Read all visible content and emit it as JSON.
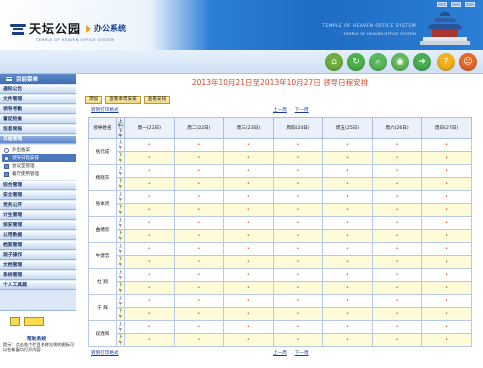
{
  "header": {
    "logo_text": "天坛公园",
    "logo_subtitle": "办公系统",
    "logo_en": "TEMPLE OF HEAVEN OFFICE SYSTEM",
    "en_title": "TEMPLE OF HEAVEN OFFICE SYSTEM",
    "en_subtitle": "TEMPLE OF HEAVEN OFFICE SYSTEM"
  },
  "toolbar": {
    "buttons": [
      {
        "icon": "home-icon",
        "color": "#6fae3e"
      },
      {
        "icon": "refresh-icon",
        "color": "#4bb04b"
      },
      {
        "icon": "search-icon",
        "color": "#58b85a"
      },
      {
        "icon": "zoom-icon",
        "color": "#63b85c"
      },
      {
        "icon": "forward-icon",
        "color": "#4aae52"
      },
      {
        "icon": "help-icon",
        "color": "#f3b31f"
      },
      {
        "icon": "user-icon",
        "color": "#e46a2b"
      }
    ]
  },
  "sidebar": {
    "title": "目前菜单",
    "items_top": [
      "通知公告",
      "文件管理",
      "领导考勤",
      "督促检查",
      "信息简报",
      "日程管理"
    ],
    "sub_items": [
      {
        "label": "外出备案",
        "selected": false
      },
      {
        "label": "领导日程安排",
        "selected": true
      },
      {
        "label": "会议室管理",
        "selected": false
      },
      {
        "label": "餐厅使用管理",
        "selected": false
      }
    ],
    "items_bottom": [
      "综合管理",
      "安全管理",
      "党务公开",
      "计生管理",
      "保安管理",
      "公用数据",
      "档案管理",
      "观子操作",
      "文档管理",
      "系统管理",
      "个人工具箱"
    ],
    "help_title": "帮助系统",
    "help_text": "提示：点击各个栏目名称左侧的图标可以在新窗口打开内容"
  },
  "main": {
    "title": "2013年10月21日至2013年10月27日 领导日程安排",
    "buttons": [
      "添加",
      "查看本周安排",
      "查看安排"
    ],
    "print_link": "转到打印格式",
    "prev_week": "上一周",
    "next_week": "下一周",
    "table": {
      "name_header": "领导姓名",
      "ap_header": "上午/下午",
      "am_label": "上午",
      "pm_label": "下午",
      "dot": "•",
      "days": [
        "周一(21日)",
        "周二(22日)",
        "周三(23日)",
        "周四(24日)",
        "周五(25日)",
        "周六(26日)",
        "周日(27日)"
      ],
      "leaders": [
        "张元成",
        "杨晓东",
        "张本贤",
        "曲绪欣",
        "牛建忠",
        "杜 翔",
        "于 辉",
        "段连和"
      ]
    }
  }
}
